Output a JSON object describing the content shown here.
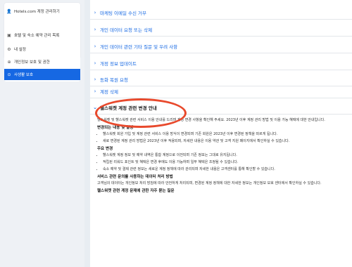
{
  "sidebar": {
    "items": [
      {
        "icon": "user-icon",
        "glyph": "👤",
        "label": "Hotels.com 계정 관리하기"
      },
      {
        "icon": "clipboard-icon",
        "glyph": "▣",
        "label": "호텔 및 숙소 예약 관리 목록"
      },
      {
        "icon": "gear-icon",
        "glyph": "⚙",
        "label": "내 설정"
      },
      {
        "icon": "shield-icon",
        "glyph": "⊕",
        "label": "개인정보 보호 및 권한"
      },
      {
        "icon": "lock-icon",
        "glyph": "⊙",
        "label": "사생활 보호"
      }
    ]
  },
  "main": {
    "accordion": [
      {
        "label": "마케팅 이메일 수신 거부",
        "open": false
      },
      {
        "label": "개인 데이터 요청 또는 삭제",
        "open": false
      },
      {
        "label": "개인 데이터 관련 기타 질문 및 우려 사항",
        "open": false
      },
      {
        "label": "개정 정보 업데이트",
        "open": false
      },
      {
        "label": "동화 복원 요청",
        "open": false
      },
      {
        "label": "계정 삭제",
        "open": false
      },
      {
        "label": "헬스워켓 계정 관련 변경 안내",
        "open": true
      }
    ],
    "intro": "헬스워켓 및 헬스워켓 관련 서비스 이용 안내를 드리며 계정 변경 사항을 확인해 주세요. 2023년 이후 계정 관리 방법 및 이용 가능 혜택에 대한 안내입니다.",
    "section1_title": "변경되는 내용 및 일정",
    "section1_items": [
      "헬스워켓 회원 가입 및 계정 관련 서비스 이용 방식이 변경되며 기존 회원은 2023년 이후 변경된 정책을 따르게 됩니다.",
      "새로 변경된 계정 관리 방법은 2023년 이후 적용되며, 자세한 내용은 이용 약관 및 고객 지원 페이지에서 확인하실 수 있습니다."
    ],
    "section2_title": "주요 변경",
    "section2_items": [
      "헬스워켓 계정 정보 및 예약 내역은 통합 계정으로 이전되며 기존 정보는 그대로 유지됩니다.",
      "적립된 리워드 포인트 및 혜택은 변경 후에도 이용 가능하며 일부 혜택은 조정될 수 있습니다.",
      "숙소 예약 및 결제 관련 정보는 새로운 계정 정책에 따라 관리되며 자세한 내용은 고객센터를 통해 확인할 수 있습니다."
    ],
    "section3_title": "서비스 관련 문의를 사용하는 데이터 처리 방법",
    "section3_text": "고객님의 데이터는 개인정보 처리 방침에 따라 안전하게 처리되며, 변경된 계정 정책에 대한 자세한 정보는 개인정보 보호 센터에서 확인하실 수 있습니다.",
    "section4_title": "헬스워켓 관련 계정 문제에 관한 자주 묻는 질문"
  }
}
